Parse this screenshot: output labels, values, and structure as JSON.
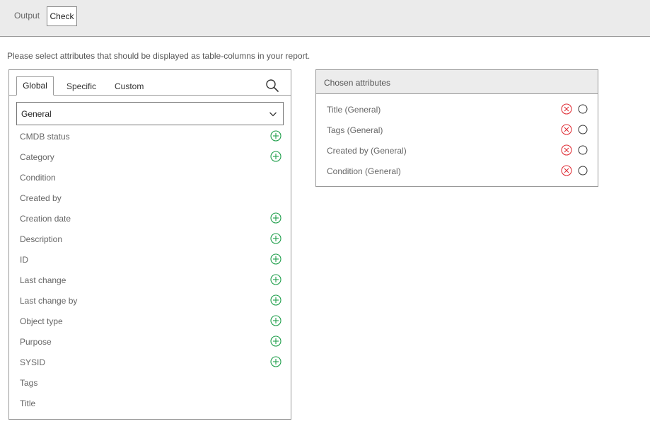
{
  "top_tabs": [
    {
      "label": "Output",
      "active": false
    },
    {
      "label": "Check",
      "active": true
    }
  ],
  "instruction": "Please select attributes that should be displayed as table-columns in your report.",
  "left_panel": {
    "tabs": [
      {
        "label": "Global",
        "active": true
      },
      {
        "label": "Specific",
        "active": false
      },
      {
        "label": "Custom",
        "active": false
      }
    ],
    "search_icon": "search-icon",
    "select": {
      "value": "General"
    },
    "attributes": [
      {
        "label": "CMDB status",
        "addable": true
      },
      {
        "label": "Category",
        "addable": true
      },
      {
        "label": "Condition",
        "addable": false
      },
      {
        "label": "Created by",
        "addable": false
      },
      {
        "label": "Creation date",
        "addable": true
      },
      {
        "label": "Description",
        "addable": true
      },
      {
        "label": "ID",
        "addable": true
      },
      {
        "label": "Last change",
        "addable": true
      },
      {
        "label": "Last change by",
        "addable": true
      },
      {
        "label": "Object type",
        "addable": true
      },
      {
        "label": "Purpose",
        "addable": true
      },
      {
        "label": "SYSID",
        "addable": true
      },
      {
        "label": "Tags",
        "addable": false
      },
      {
        "label": "Title",
        "addable": false
      }
    ]
  },
  "right_panel": {
    "title": "Chosen attributes",
    "items": [
      {
        "label": "Title (General)"
      },
      {
        "label": "Tags (General)"
      },
      {
        "label": "Created by (General)"
      },
      {
        "label": "Condition (General)"
      }
    ]
  },
  "colors": {
    "add": "#1e9e4a",
    "remove": "#e0323a",
    "topbar_bg": "#ebebeb",
    "border": "#999999"
  }
}
